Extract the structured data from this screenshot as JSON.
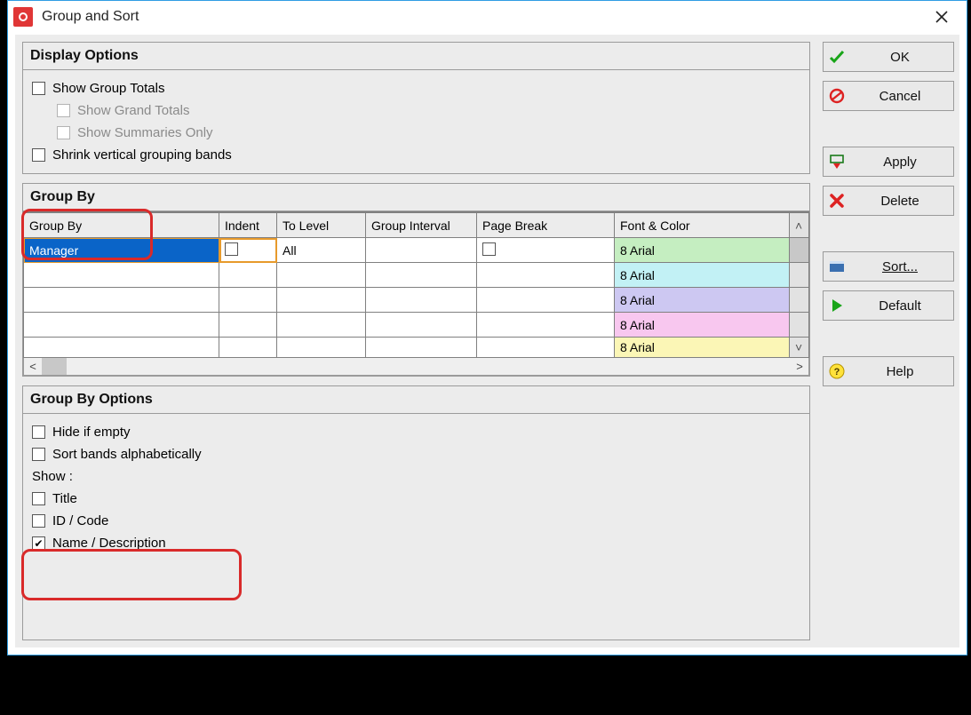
{
  "window": {
    "title": "Group and Sort"
  },
  "panels": {
    "display": {
      "title": "Display Options",
      "show_group_totals": "Show Group Totals",
      "show_grand_totals": "Show Grand Totals",
      "show_summaries_only": "Show Summaries Only",
      "shrink_bands": "Shrink vertical grouping bands"
    },
    "groupby": {
      "title": "Group By",
      "columns": {
        "group_by": "Group By",
        "indent": "Indent",
        "to_level": "To Level",
        "group_interval": "Group Interval",
        "page_break": "Page Break",
        "font_color": "Font & Color"
      },
      "rows": [
        {
          "group_by": "Manager",
          "indent_checked": false,
          "to_level": "All",
          "group_interval": "",
          "page_break_checked": false,
          "font": "8 Arial",
          "font_class": "font-green",
          "selected": true
        },
        {
          "group_by": "",
          "indent_checked": null,
          "to_level": "",
          "group_interval": "",
          "page_break_checked": null,
          "font": "8 Arial",
          "font_class": "font-cyan",
          "selected": false
        },
        {
          "group_by": "",
          "indent_checked": null,
          "to_level": "",
          "group_interval": "",
          "page_break_checked": null,
          "font": "8 Arial",
          "font_class": "font-purple",
          "selected": false
        },
        {
          "group_by": "",
          "indent_checked": null,
          "to_level": "",
          "group_interval": "",
          "page_break_checked": null,
          "font": "8 Arial",
          "font_class": "font-pink",
          "selected": false
        },
        {
          "group_by": "",
          "indent_checked": null,
          "to_level": "",
          "group_interval": "",
          "page_break_checked": null,
          "font": "8 Arial",
          "font_class": "font-yellow",
          "selected": false
        }
      ]
    },
    "options": {
      "title": "Group By Options",
      "hide_if_empty": "Hide if empty",
      "sort_alpha": "Sort bands alphabetically",
      "show_label": "Show :",
      "title_chk": "Title",
      "id_code": "ID / Code",
      "name_desc": "Name / Description"
    }
  },
  "buttons": {
    "ok": "OK",
    "cancel": "Cancel",
    "apply": "Apply",
    "delete": "Delete",
    "sort": "Sort...",
    "default": "Default",
    "help": "Help"
  }
}
